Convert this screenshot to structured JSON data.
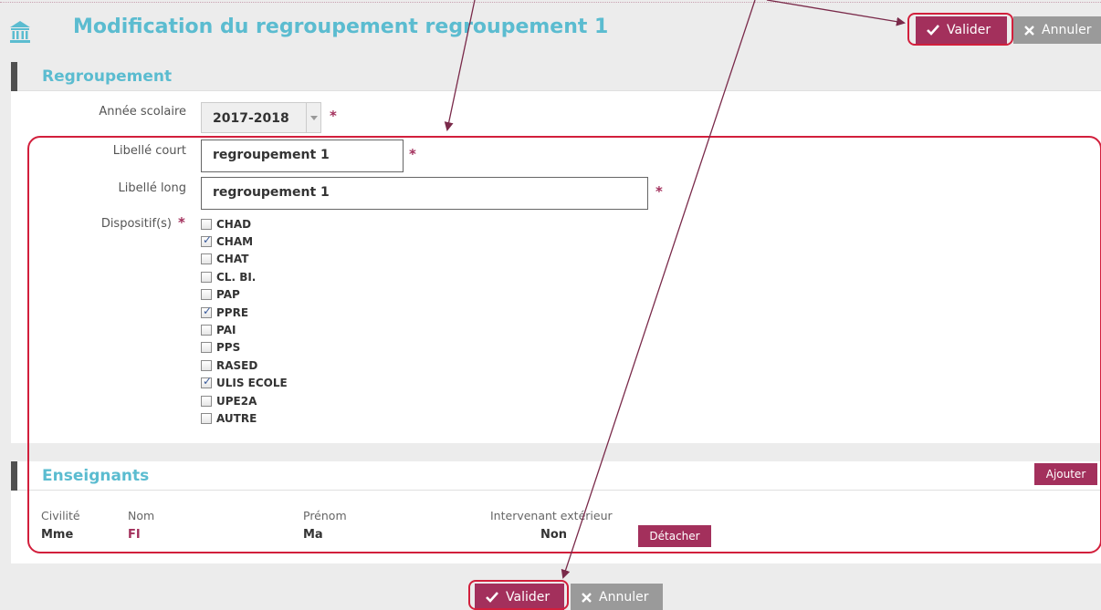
{
  "header": {
    "title": "Modification du regroupement regroupement 1",
    "valider_label": "Valider",
    "annuler_label": "Annuler"
  },
  "regroupement": {
    "section_title": "Regroupement",
    "annee_label": "Année scolaire",
    "annee_value": "2017-2018",
    "libelle_court_label": "Libellé court",
    "libelle_court_value": "regroupement 1",
    "libelle_long_label": "Libellé long",
    "libelle_long_value": "regroupement 1",
    "dispositifs_label": "Dispositif(s)",
    "required_marker": "*",
    "dispositifs": [
      {
        "label": "CHAD",
        "checked": false
      },
      {
        "label": "CHAM",
        "checked": true
      },
      {
        "label": "CHAT",
        "checked": false
      },
      {
        "label": "CL. BI.",
        "checked": false
      },
      {
        "label": "PAP",
        "checked": false
      },
      {
        "label": "PPRE",
        "checked": true
      },
      {
        "label": "PAI",
        "checked": false
      },
      {
        "label": "PPS",
        "checked": false
      },
      {
        "label": "RASED",
        "checked": false
      },
      {
        "label": "ULIS ECOLE",
        "checked": true
      },
      {
        "label": "UPE2A",
        "checked": false
      },
      {
        "label": "AUTRE",
        "checked": false
      }
    ]
  },
  "enseignants": {
    "section_title": "Enseignants",
    "ajouter_label": "Ajouter",
    "columns": [
      "Civilité",
      "Nom",
      "Prénom",
      "Intervenant extérieur"
    ],
    "rows": [
      {
        "civilite": "Mme",
        "nom": "FI",
        "prenom": "Ma",
        "intervenant": "Non",
        "action": "Détacher"
      }
    ]
  },
  "footer": {
    "valider_label": "Valider",
    "annuler_label": "Annuler"
  },
  "colors": {
    "accent": "#a3305c",
    "title": "#5bbcd0",
    "annotation_red": "#d21f3c",
    "arrow": "#7a2a4a"
  }
}
